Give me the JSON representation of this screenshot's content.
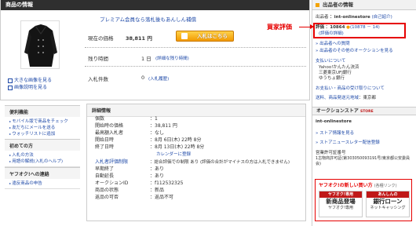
{
  "product": {
    "header": "商品の情報",
    "premium_notice": "プレミアム会員なら落札後もあんしん補償",
    "price_label": "現在の価格",
    "price_value": "38,811 円",
    "bid_button": "入札はこちら",
    "time_label": "残り時間",
    "time_value": "1 日",
    "time_link": "(詳細な残り時間)",
    "bids_label": "入札件数",
    "bids_value": "0",
    "bids_link": "(入札履歴)",
    "photo_links": [
      "大きな画像を見る",
      "画像説明を見る"
    ]
  },
  "side_sections": [
    {
      "title": "便利機能",
      "items": [
        "モバイル版で商品をチェック",
        "友だちにメールを送る",
        "ウォッチリストに追加"
      ]
    },
    {
      "title": "初めての方",
      "items": [
        "入札の方法",
        "用語の解説(入札のヘルプ)"
      ]
    },
    {
      "title": "ヤフオク!への連絡",
      "items": [
        "違反商品の申告"
      ]
    }
  ],
  "detail": {
    "header": "詳細情報",
    "rows": [
      {
        "label": "個数",
        "value": "：1"
      },
      {
        "label": "開始時の価格",
        "value": "：38,811 円"
      },
      {
        "label": "最高額入札者",
        "value": "：なし"
      },
      {
        "label": "開始日時",
        "value": "：8月 6日(木) 22時 8分"
      },
      {
        "label": "終了日時",
        "value": "：8月 13日(木) 22時 8分"
      },
      {
        "label": "",
        "value": "カレンダーに登録"
      },
      {
        "label": "入札者評価制限",
        "value": "：総合評価での制限 あり (評価の合計がマイナスの方は入札できません)"
      },
      {
        "label": "早期終了",
        "value": "：あり"
      },
      {
        "label": "自動延長",
        "value": "：あり"
      },
      {
        "label": "オークションID",
        "value": "：f112532325"
      },
      {
        "label": "商品の状態",
        "value": "：新品"
      },
      {
        "label": "返品の可否",
        "value": "：返品不可"
      }
    ]
  },
  "seller": {
    "header": "出品者の情報",
    "seller_label": "出品者",
    "seller_id": "：int-onlinestore",
    "seller_link": "(自己紹介)",
    "rating_label": "評価",
    "rating_value": "：10864",
    "rating_breakdown": "(10878 － 14)",
    "rating_link": "(評価の詳細)",
    "annotation": "買家評価",
    "links": [
      "出品者への質問",
      "出品者のその他のオークションを見る"
    ],
    "payment_header": "支払いについて",
    "payment_items": [
      "Yahoo!かんたん決済",
      "三菱東京UFJ銀行",
      "ゆうちょ銀行"
    ],
    "payment_link": "お支払い・商品の受け取りについて",
    "shipping_label": "送料、商品発送元地域",
    "shipping_value": "：東京都",
    "store_header": "オークションストア",
    "store_badge": "STORE",
    "store_name": "int-onlinestore",
    "store_links": [
      "ストア情報を見る",
      "ストアニュースレター配信登録"
    ],
    "business_label": "営業許可証番号",
    "business_value": "1古物商許可証(第303050093191号/東京都公安委員会)",
    "new_box_title": "ヤフオク!の新しい買い方",
    "new_box_link": "(各種リンク)",
    "new_box_items": [
      {
        "bar": "ヤフオク!専用",
        "big": "新商品登場",
        "sub": "ヤフオク!専用"
      },
      {
        "bar": "あんしんの",
        "big": "銀行ローン",
        "sub": "ネットキャッシング"
      }
    ]
  }
}
